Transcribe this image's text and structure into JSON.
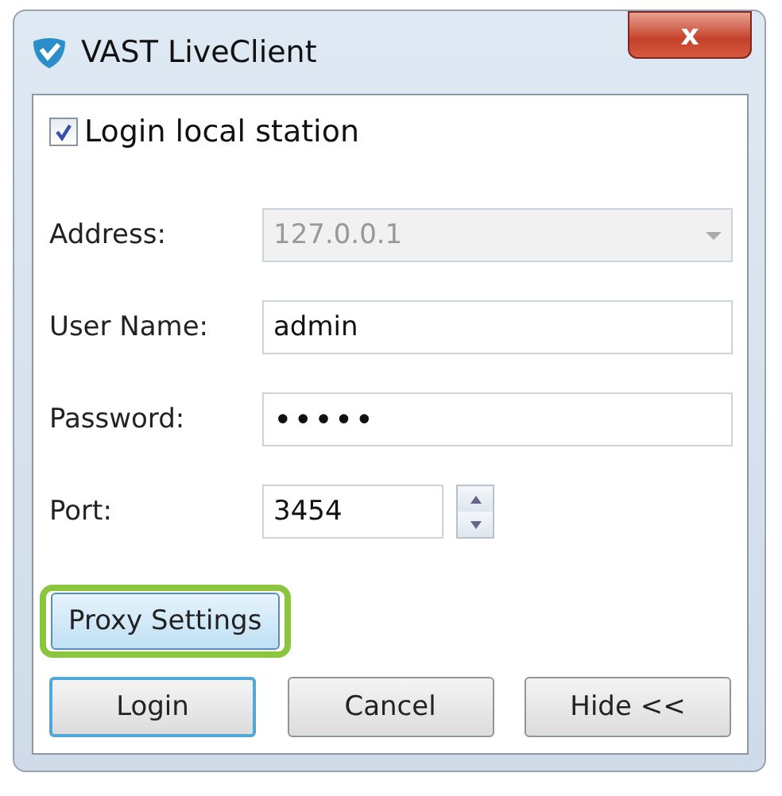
{
  "window": {
    "title": "VAST LiveClient",
    "close": "x"
  },
  "login_local": {
    "label": "Login local station",
    "checked": true
  },
  "fields": [
    {
      "kind": "combo",
      "label": "Address:",
      "value": "127.0.0.1",
      "disabled": true
    },
    {
      "kind": "text",
      "label": "User Name:",
      "value": "admin",
      "disabled": false
    },
    {
      "kind": "password",
      "label": "Password:",
      "value": "•••••",
      "disabled": false
    },
    {
      "kind": "spin",
      "label": "Port:",
      "value": "3454",
      "disabled": false
    }
  ],
  "proxy_button": {
    "label": "Proxy Settings",
    "highlighted": true
  },
  "buttons": [
    {
      "label": "Login",
      "selected": true
    },
    {
      "label": "Cancel",
      "selected": false
    },
    {
      "label": "Hide <<",
      "selected": false
    }
  ]
}
